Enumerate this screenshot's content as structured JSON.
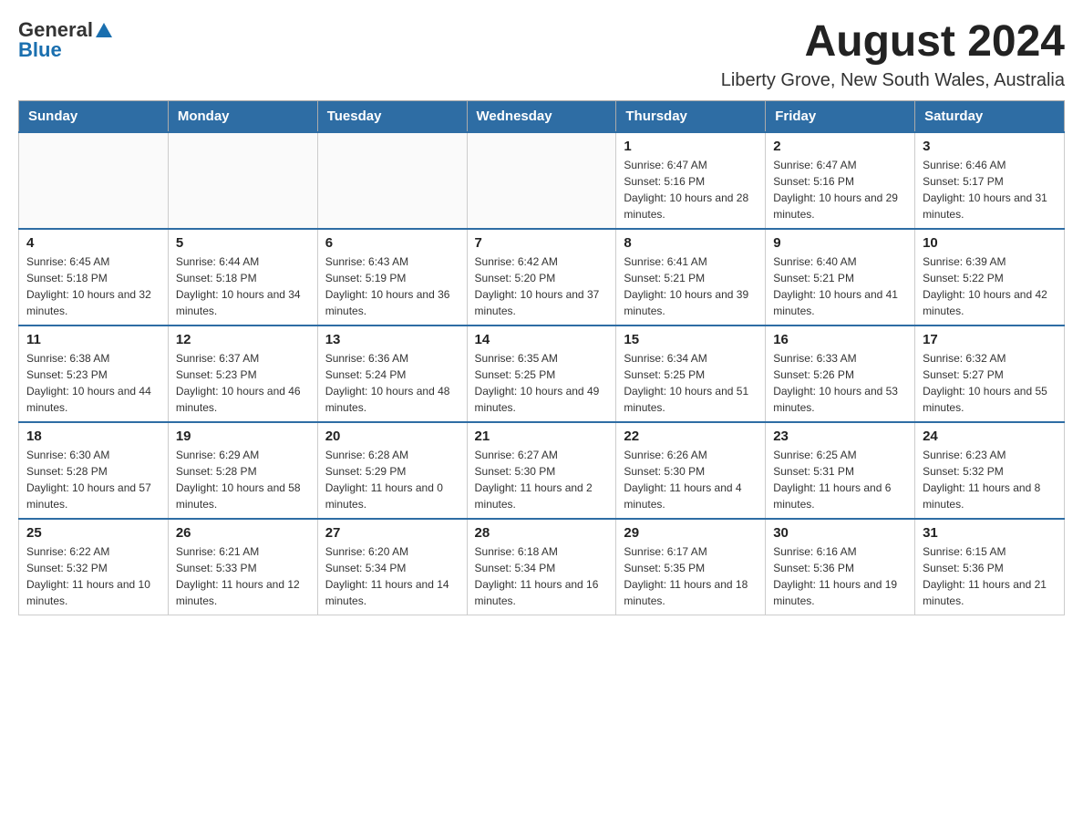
{
  "header": {
    "logo_general": "General",
    "logo_blue": "Blue",
    "title": "August 2024",
    "subtitle": "Liberty Grove, New South Wales, Australia"
  },
  "days_of_week": [
    "Sunday",
    "Monday",
    "Tuesday",
    "Wednesday",
    "Thursday",
    "Friday",
    "Saturday"
  ],
  "weeks": [
    [
      {
        "day": "",
        "info": ""
      },
      {
        "day": "",
        "info": ""
      },
      {
        "day": "",
        "info": ""
      },
      {
        "day": "",
        "info": ""
      },
      {
        "day": "1",
        "info": "Sunrise: 6:47 AM\nSunset: 5:16 PM\nDaylight: 10 hours and 28 minutes."
      },
      {
        "day": "2",
        "info": "Sunrise: 6:47 AM\nSunset: 5:16 PM\nDaylight: 10 hours and 29 minutes."
      },
      {
        "day": "3",
        "info": "Sunrise: 6:46 AM\nSunset: 5:17 PM\nDaylight: 10 hours and 31 minutes."
      }
    ],
    [
      {
        "day": "4",
        "info": "Sunrise: 6:45 AM\nSunset: 5:18 PM\nDaylight: 10 hours and 32 minutes."
      },
      {
        "day": "5",
        "info": "Sunrise: 6:44 AM\nSunset: 5:18 PM\nDaylight: 10 hours and 34 minutes."
      },
      {
        "day": "6",
        "info": "Sunrise: 6:43 AM\nSunset: 5:19 PM\nDaylight: 10 hours and 36 minutes."
      },
      {
        "day": "7",
        "info": "Sunrise: 6:42 AM\nSunset: 5:20 PM\nDaylight: 10 hours and 37 minutes."
      },
      {
        "day": "8",
        "info": "Sunrise: 6:41 AM\nSunset: 5:21 PM\nDaylight: 10 hours and 39 minutes."
      },
      {
        "day": "9",
        "info": "Sunrise: 6:40 AM\nSunset: 5:21 PM\nDaylight: 10 hours and 41 minutes."
      },
      {
        "day": "10",
        "info": "Sunrise: 6:39 AM\nSunset: 5:22 PM\nDaylight: 10 hours and 42 minutes."
      }
    ],
    [
      {
        "day": "11",
        "info": "Sunrise: 6:38 AM\nSunset: 5:23 PM\nDaylight: 10 hours and 44 minutes."
      },
      {
        "day": "12",
        "info": "Sunrise: 6:37 AM\nSunset: 5:23 PM\nDaylight: 10 hours and 46 minutes."
      },
      {
        "day": "13",
        "info": "Sunrise: 6:36 AM\nSunset: 5:24 PM\nDaylight: 10 hours and 48 minutes."
      },
      {
        "day": "14",
        "info": "Sunrise: 6:35 AM\nSunset: 5:25 PM\nDaylight: 10 hours and 49 minutes."
      },
      {
        "day": "15",
        "info": "Sunrise: 6:34 AM\nSunset: 5:25 PM\nDaylight: 10 hours and 51 minutes."
      },
      {
        "day": "16",
        "info": "Sunrise: 6:33 AM\nSunset: 5:26 PM\nDaylight: 10 hours and 53 minutes."
      },
      {
        "day": "17",
        "info": "Sunrise: 6:32 AM\nSunset: 5:27 PM\nDaylight: 10 hours and 55 minutes."
      }
    ],
    [
      {
        "day": "18",
        "info": "Sunrise: 6:30 AM\nSunset: 5:28 PM\nDaylight: 10 hours and 57 minutes."
      },
      {
        "day": "19",
        "info": "Sunrise: 6:29 AM\nSunset: 5:28 PM\nDaylight: 10 hours and 58 minutes."
      },
      {
        "day": "20",
        "info": "Sunrise: 6:28 AM\nSunset: 5:29 PM\nDaylight: 11 hours and 0 minutes."
      },
      {
        "day": "21",
        "info": "Sunrise: 6:27 AM\nSunset: 5:30 PM\nDaylight: 11 hours and 2 minutes."
      },
      {
        "day": "22",
        "info": "Sunrise: 6:26 AM\nSunset: 5:30 PM\nDaylight: 11 hours and 4 minutes."
      },
      {
        "day": "23",
        "info": "Sunrise: 6:25 AM\nSunset: 5:31 PM\nDaylight: 11 hours and 6 minutes."
      },
      {
        "day": "24",
        "info": "Sunrise: 6:23 AM\nSunset: 5:32 PM\nDaylight: 11 hours and 8 minutes."
      }
    ],
    [
      {
        "day": "25",
        "info": "Sunrise: 6:22 AM\nSunset: 5:32 PM\nDaylight: 11 hours and 10 minutes."
      },
      {
        "day": "26",
        "info": "Sunrise: 6:21 AM\nSunset: 5:33 PM\nDaylight: 11 hours and 12 minutes."
      },
      {
        "day": "27",
        "info": "Sunrise: 6:20 AM\nSunset: 5:34 PM\nDaylight: 11 hours and 14 minutes."
      },
      {
        "day": "28",
        "info": "Sunrise: 6:18 AM\nSunset: 5:34 PM\nDaylight: 11 hours and 16 minutes."
      },
      {
        "day": "29",
        "info": "Sunrise: 6:17 AM\nSunset: 5:35 PM\nDaylight: 11 hours and 18 minutes."
      },
      {
        "day": "30",
        "info": "Sunrise: 6:16 AM\nSunset: 5:36 PM\nDaylight: 11 hours and 19 minutes."
      },
      {
        "day": "31",
        "info": "Sunrise: 6:15 AM\nSunset: 5:36 PM\nDaylight: 11 hours and 21 minutes."
      }
    ]
  ]
}
